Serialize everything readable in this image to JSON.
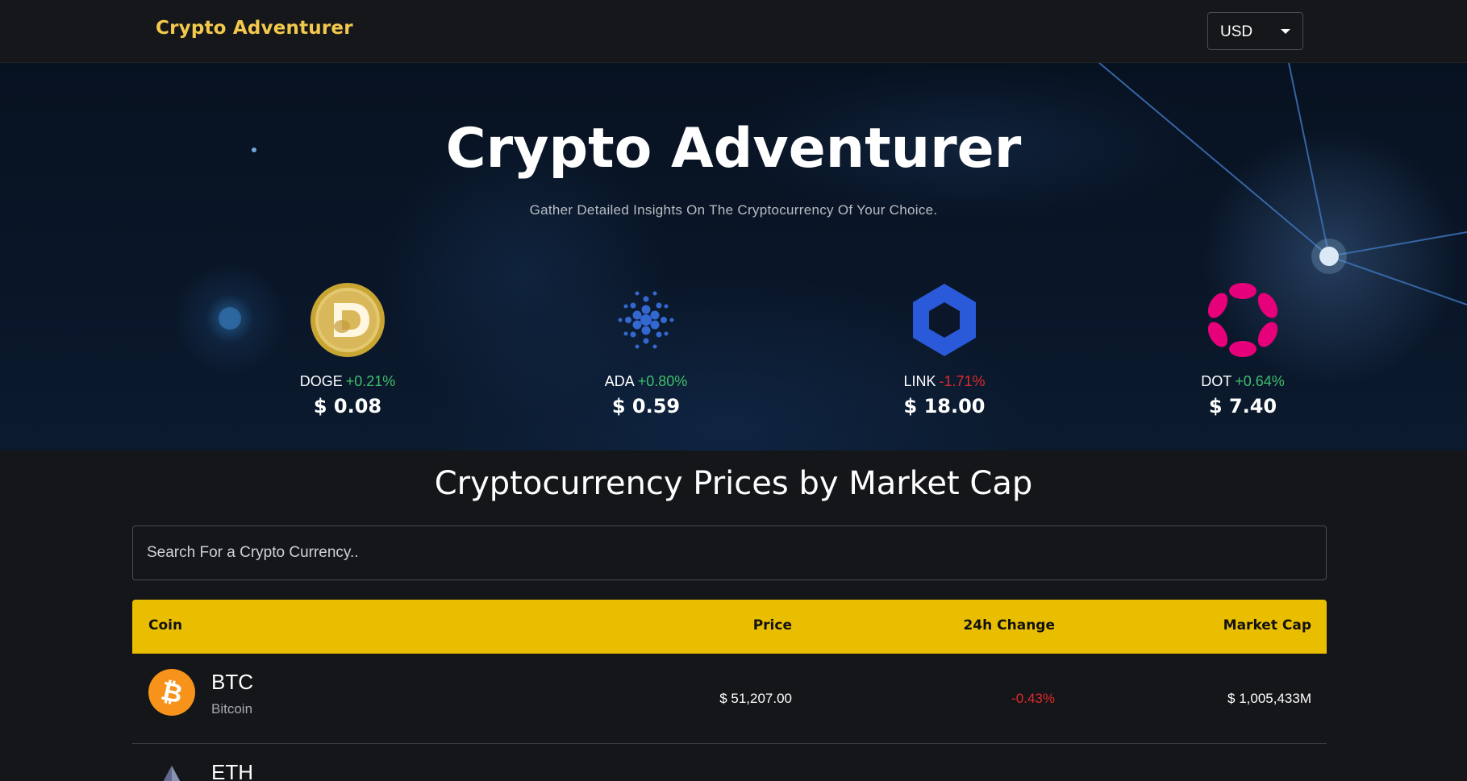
{
  "navbar": {
    "brand": "Crypto Adventurer",
    "currency": "USD"
  },
  "hero": {
    "title": "Crypto Adventurer",
    "subtitle": "Gather Detailed Insights On The Cryptocurrency Of Your Choice.",
    "coins": [
      {
        "symbol": "DOGE",
        "change": "+0.21%",
        "change_direction": "up",
        "price": "$ 0.08",
        "icon": "doge-logo-icon",
        "color": "#c9a633"
      },
      {
        "symbol": "ADA",
        "change": "+0.80%",
        "change_direction": "up",
        "price": "$ 0.59",
        "icon": "cardano-logo-icon",
        "color": "#3468d1"
      },
      {
        "symbol": "LINK",
        "change": "-1.71%",
        "change_direction": "down",
        "price": "$ 18.00",
        "icon": "chainlink-logo-icon",
        "color": "#2a5ada"
      },
      {
        "symbol": "DOT",
        "change": "+0.64%",
        "change_direction": "up",
        "price": "$ 7.40",
        "icon": "polkadot-logo-icon",
        "color": "#e6007a"
      }
    ]
  },
  "section": {
    "title": "Cryptocurrency Prices by Market Cap",
    "search_placeholder": "Search For a Crypto Currency..",
    "search_value": ""
  },
  "table": {
    "headers": {
      "coin": "Coin",
      "price": "Price",
      "change": "24h Change",
      "market_cap": "Market Cap"
    },
    "header_color": "#eabe00",
    "rows": [
      {
        "symbol": "BTC",
        "name": "Bitcoin",
        "price": "$ 51,207.00",
        "change": "-0.43%",
        "change_direction": "down",
        "market_cap": "$ 1,005,433M",
        "icon": "bitcoin-logo-icon"
      },
      {
        "symbol": "ETH",
        "icon": "ethereum-logo-icon"
      }
    ]
  },
  "colors": {
    "accent": "#f2c94c",
    "positive": "#3fbf6a",
    "negative": "#e02a2a",
    "background": "#151619"
  }
}
